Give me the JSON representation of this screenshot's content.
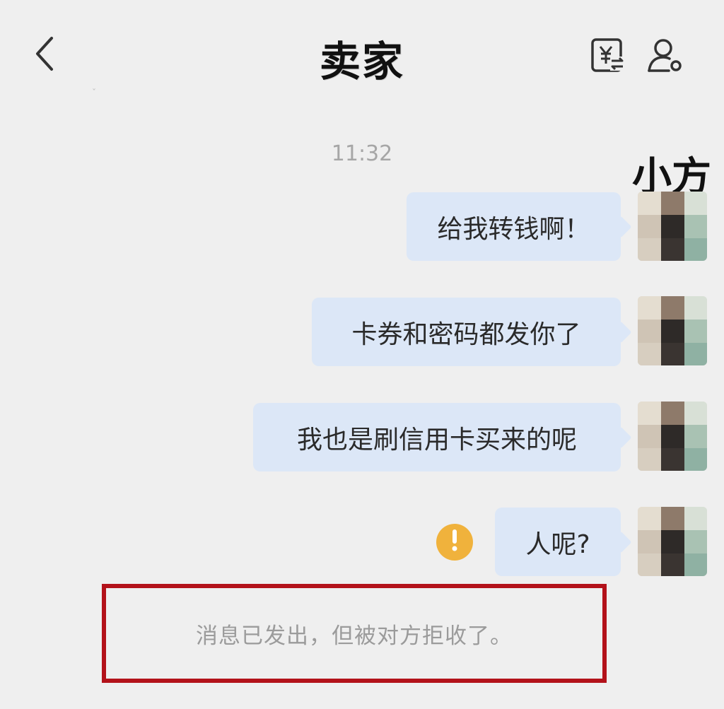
{
  "header": {
    "title": "卖家",
    "back_icon": "chevron-left-icon",
    "transfer_icon": "yuan-transfer-icon",
    "profile_icon": "person-settings-icon"
  },
  "chat": {
    "timestamp": "11:32",
    "sender_name_overlay": "小方",
    "messages": [
      {
        "text": "给我转钱啊！",
        "failed": false
      },
      {
        "text": "卡券和密码都发你了",
        "failed": false
      },
      {
        "text": "我也是刷信用卡买来的呢",
        "failed": false
      },
      {
        "text": "人呢?",
        "failed": true
      }
    ],
    "system_notice": "消息已发出，但被对方拒收了。"
  },
  "colors": {
    "background": "#efefef",
    "bubble": "#dce7f7",
    "alert": "#f0b23c",
    "highlight": "#b3121a"
  }
}
